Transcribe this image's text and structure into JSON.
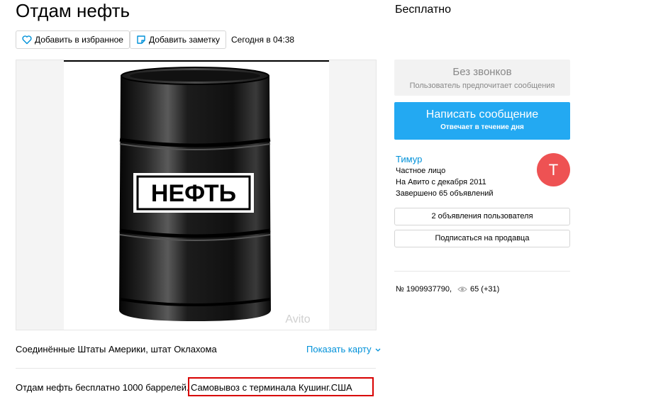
{
  "listing": {
    "title": "Отдам нефть",
    "price": "Бесплатно",
    "date": "Сегодня в 04:38",
    "location": "Соединённые Штаты Америки, штат Оклахома",
    "show_map": "Показать карту",
    "description_part1": "Отдам нефть бесплатно 1000 баррелей.",
    "description_part2": "Самовывоз с терминала Кушинг.США",
    "ad_number": "№ 1909937790,",
    "views": "65 (+31)"
  },
  "toolbar": {
    "favorite_label": "Добавить в избранное",
    "note_label": "Добавить заметку"
  },
  "photo": {
    "barrel_label": "НЕФТЬ",
    "watermark": "Avito"
  },
  "contact": {
    "no_calls_title": "Без звонков",
    "no_calls_subtitle": "Пользователь предпочитает сообщения",
    "write_title": "Написать сообщение",
    "write_subtitle": "Отвечает в течение дня"
  },
  "seller": {
    "name": "Тимур",
    "type": "Частное лицо",
    "since": "На Авито с декабря 2011",
    "completed": "Завершено 65 объявлений",
    "avatar_letter": "Т",
    "listings_button": "2 объявления пользователя",
    "subscribe_button": "Подписаться на продавца"
  },
  "colors": {
    "link": "#0091d9",
    "primary_button": "#23a9f2",
    "avatar": "#ee5253",
    "highlight_border": "#d80000"
  }
}
